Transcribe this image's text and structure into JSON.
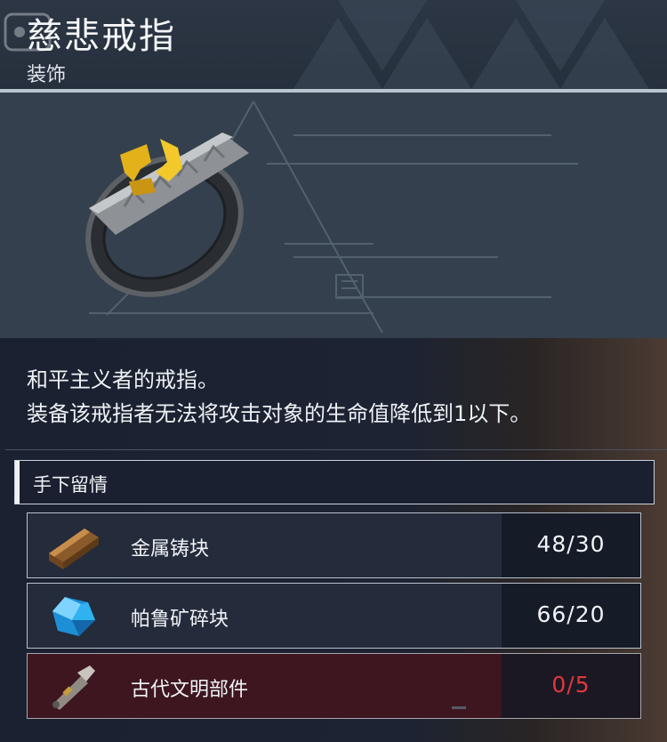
{
  "item": {
    "name": "慈悲戒指",
    "category": "装饰",
    "description": [
      "和平主义者的戒指。",
      "装备该戒指者无法将攻击对象的生命值降低到1以下。"
    ],
    "skill": "手下留情"
  },
  "materials": [
    {
      "name": "金属铸块",
      "count": "48/30",
      "icon": "metal-ingot-icon",
      "sufficient": true
    },
    {
      "name": "帕鲁矿碎块",
      "count": "66/20",
      "icon": "pal-ore-crystal-icon",
      "sufficient": true
    },
    {
      "name": "古代文明部件",
      "count": "0/5",
      "icon": "ancient-civilization-part-icon",
      "sufficient": false
    }
  ],
  "colors": {
    "insufficient_text": "#e0383c",
    "insufficient_row": "#3d1620",
    "header_line": "#b9c6cf"
  }
}
